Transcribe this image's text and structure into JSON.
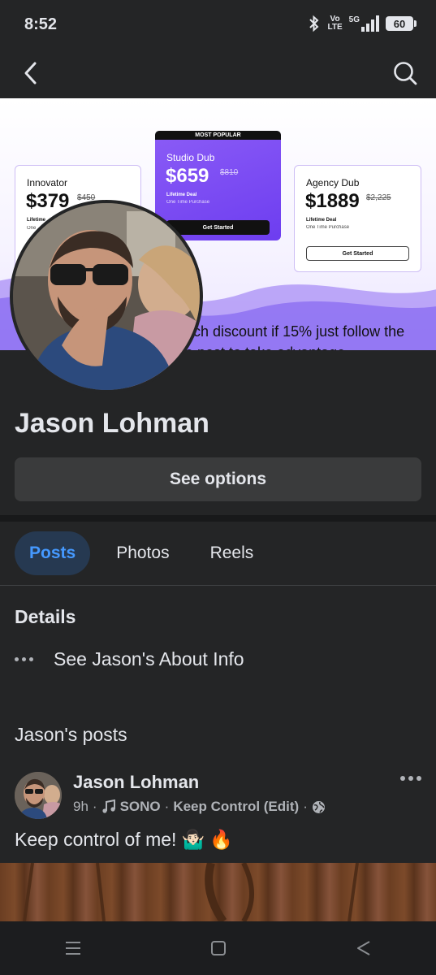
{
  "status_bar": {
    "time": "8:52",
    "network_top": "Vo",
    "network_bottom": "LTE",
    "signal_label": "5G",
    "battery": "60"
  },
  "nav": {
    "back_icon": "chevron-left-icon",
    "search_icon": "search-icon"
  },
  "cover": {
    "cards": {
      "left": {
        "name": "Innovator",
        "price": "$379",
        "old_price": "$450",
        "deal": "Lifetime",
        "once": "One"
      },
      "middle": {
        "badge": "MOST POPULAR",
        "name": "Studio Dub",
        "price": "$659",
        "old_price": "$810",
        "deal": "Lifetime Deal",
        "once": "One Time Purchase",
        "button": "Get Started"
      },
      "right": {
        "name": "Agency Dub",
        "price": "$1889",
        "old_price": "$2,225",
        "deal": "Lifetime Deal",
        "once": "One Time Purchase",
        "button": "Get Started"
      }
    },
    "caption_line1": "nch discount if 15% just follow the",
    "caption_line2": "e post to take advantage"
  },
  "profile": {
    "name": "Jason Lohman",
    "see_options": "See options"
  },
  "tabs": [
    {
      "label": "Posts",
      "active": true
    },
    {
      "label": "Photos",
      "active": false
    },
    {
      "label": "Reels",
      "active": false
    }
  ],
  "details": {
    "title": "Details",
    "about": "See Jason's About Info"
  },
  "posts_section": {
    "title": "Jason's posts"
  },
  "post": {
    "author": "Jason Lohman",
    "time": "9h",
    "separator": "·",
    "music_icon": "music-note-icon",
    "song_artist": "SONO",
    "song_title": "Keep Control (Edit)",
    "audience_icon": "globe-icon",
    "text": "Keep control of me!",
    "emoji1": "🤷🏻‍♂️",
    "emoji2": "🔥"
  },
  "colors": {
    "background": "#242526",
    "accent_blue": "#4599ff",
    "active_tab_bg": "#263951",
    "button_bg": "#3a3b3c"
  }
}
